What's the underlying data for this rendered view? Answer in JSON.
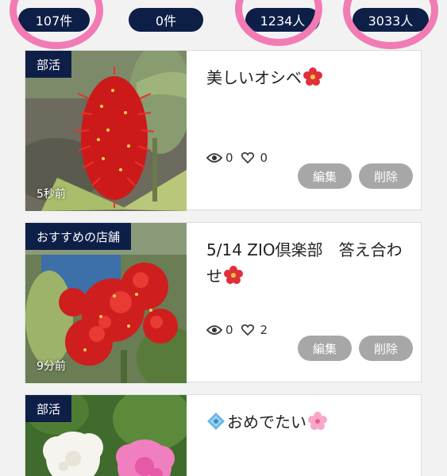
{
  "stats": [
    {
      "label": "107件"
    },
    {
      "label": "0件"
    },
    {
      "label": "1234人"
    },
    {
      "label": "3033人"
    }
  ],
  "posts": [
    {
      "category": "部活",
      "time": "5秒前",
      "title": "美しいオシベ",
      "title_emoji": "hibiscus",
      "views": "0",
      "likes": "0",
      "edit_label": "編集",
      "delete_label": "削除"
    },
    {
      "category": "おすすめの店舗",
      "time": "9分前",
      "title": "5/14 ZIO倶楽部　答え合わせ",
      "title_emoji": "hibiscus",
      "views": "0",
      "likes": "2",
      "edit_label": "編集",
      "delete_label": "削除"
    },
    {
      "category": "部活",
      "title": "おめでたい",
      "title_emoji_before": "diamond-with-dot",
      "title_emoji": "cherry-blossom"
    }
  ],
  "colors": {
    "accent_navy": "#0e1f47",
    "highlight_ring": "#f27bb3",
    "button_gray": "#a7a7a7"
  },
  "icons": {
    "views": "eye-icon",
    "likes": "heart-icon"
  }
}
